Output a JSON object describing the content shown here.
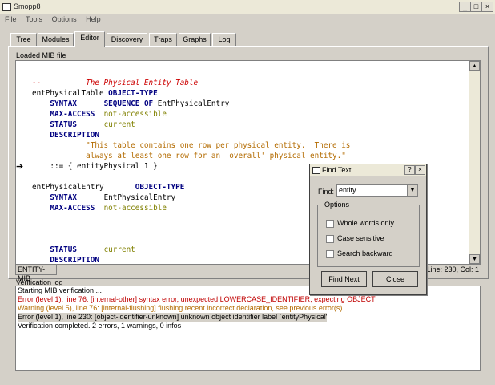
{
  "window": {
    "title": "Smopp8",
    "minimize": "_",
    "maximize": "□",
    "close": "×"
  },
  "menu": [
    "File",
    "Tools",
    "Options",
    "Help"
  ],
  "tabs": [
    "Tree",
    "Modules",
    "Editor",
    "Discovery",
    "Traps",
    "Graphs",
    "Log"
  ],
  "active_tab": "Editor",
  "editor": {
    "label": "Loaded MIB file",
    "lines": [
      [
        {
          "t": "--          The Physical Entity Table",
          "c": "cmt"
        }
      ],
      [
        {
          "t": "entPhysicalTable ",
          "c": ""
        },
        {
          "t": "OBJECT-TYPE",
          "c": "kw"
        }
      ],
      [
        {
          "t": "    ",
          "c": ""
        },
        {
          "t": "SYNTAX",
          "c": "kw"
        },
        {
          "t": "      ",
          "c": ""
        },
        {
          "t": "SEQUENCE OF",
          "c": "kw"
        },
        {
          "t": " EntPhysicalEntry",
          "c": ""
        }
      ],
      [
        {
          "t": "    ",
          "c": ""
        },
        {
          "t": "MAX-ACCESS",
          "c": "kw"
        },
        {
          "t": "  ",
          "c": ""
        },
        {
          "t": "not-accessible",
          "c": "val"
        }
      ],
      [
        {
          "t": "    ",
          "c": ""
        },
        {
          "t": "STATUS",
          "c": "kw"
        },
        {
          "t": "      ",
          "c": ""
        },
        {
          "t": "current",
          "c": "val"
        }
      ],
      [
        {
          "t": "    ",
          "c": ""
        },
        {
          "t": "DESCRIPTION",
          "c": "kw"
        }
      ],
      [
        {
          "t": "            \"This table contains one row per physical entity.  There is",
          "c": "str"
        }
      ],
      [
        {
          "t": "            always at least one row for an 'overall' physical entity.\"",
          "c": "str"
        }
      ],
      [
        {
          "t": "    ::= { entityPhysical 1 }",
          "c": ""
        }
      ],
      [
        {
          "t": "",
          "c": ""
        }
      ],
      [
        {
          "t": "entPhysicalEntry       ",
          "c": ""
        },
        {
          "t": "OBJECT-TYPE",
          "c": "kw"
        }
      ],
      [
        {
          "t": "    ",
          "c": ""
        },
        {
          "t": "SYNTAX",
          "c": "kw"
        },
        {
          "t": "      EntPhysicalEntry",
          "c": ""
        }
      ],
      [
        {
          "t": "    ",
          "c": ""
        },
        {
          "t": "MAX-ACCESS",
          "c": "kw"
        },
        {
          "t": "  ",
          "c": ""
        },
        {
          "t": "not-accessible",
          "c": "val"
        }
      ],
      [
        {
          "t": "",
          "c": ""
        }
      ],
      [
        {
          "t": "",
          "c": ""
        }
      ],
      [
        {
          "t": "",
          "c": ""
        }
      ],
      [
        {
          "t": "    ",
          "c": ""
        },
        {
          "t": "STATUS",
          "c": "kw"
        },
        {
          "t": "      ",
          "c": ""
        },
        {
          "t": "current",
          "c": "val"
        }
      ],
      [
        {
          "t": "    ",
          "c": ""
        },
        {
          "t": "DESCRIPTION",
          "c": "kw"
        }
      ]
    ]
  },
  "status": {
    "module": "ENTITY-MIB",
    "position": "Line: 230, Col: 1"
  },
  "log": {
    "label": "Verification log",
    "entries": [
      {
        "text": "Starting MIB verification ...",
        "level": "info"
      },
      {
        "text": "Error (level 1), line 76: [internal-other] syntax error, unexpected LOWERCASE_IDENTIFIER, expecting OBJECT",
        "level": "err"
      },
      {
        "text": "Warning (level 5), line 76: [internal-flushing] flushing recent incorrect declaration, see previous error(s)",
        "level": "warn"
      },
      {
        "text": "Error (level 1), line 230: [object-identifier-unknown] unknown object identifier label `entityPhysical'",
        "level": "sel"
      },
      {
        "text": "Verification completed. 2 errors, 1 warnings, 0 infos",
        "level": "info"
      }
    ]
  },
  "find_dialog": {
    "title": "Find Text",
    "help": "?",
    "close": "×",
    "find_label": "Find:",
    "find_value": "entity",
    "options_label": "Options",
    "options": [
      {
        "label": "Whole words only",
        "checked": false
      },
      {
        "label": "Case sensitive",
        "checked": false
      },
      {
        "label": "Search backward",
        "checked": false
      }
    ],
    "find_next": "Find Next",
    "close_button": "Close"
  },
  "colors": {
    "keyword": "#000080",
    "value": "#808000",
    "string": "#b36b00",
    "comment": "#cc0000",
    "error": "#c00000"
  }
}
